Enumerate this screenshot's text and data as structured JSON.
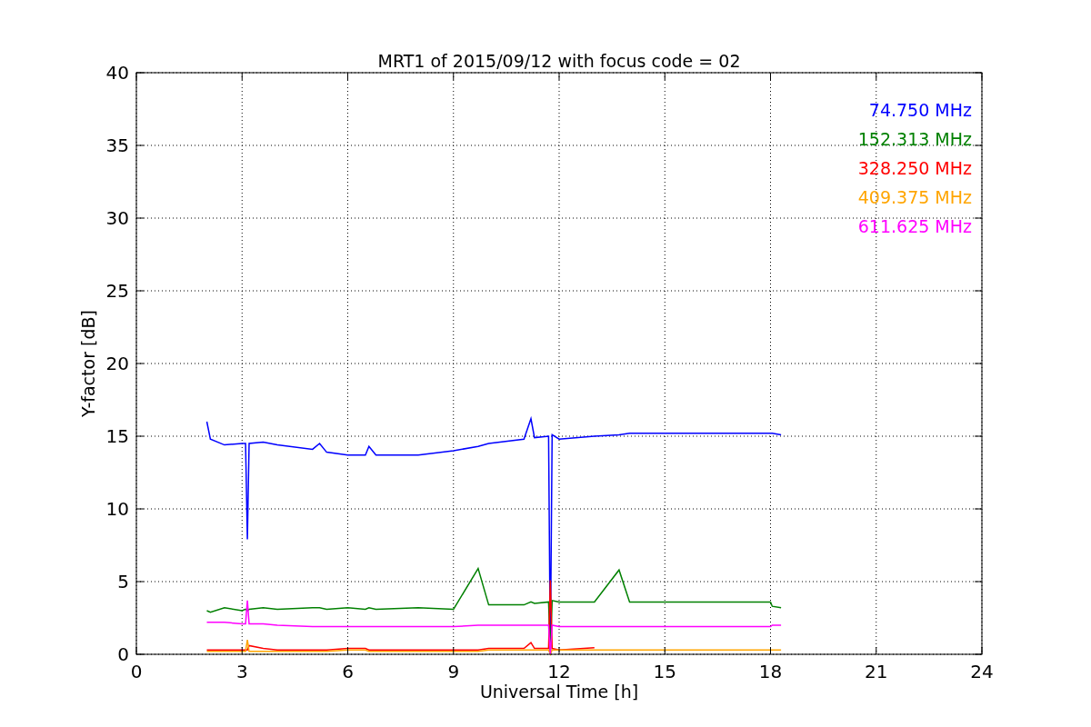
{
  "figure": {
    "chart_data": {
      "type": "line",
      "title": "MRT1 of 2015/09/12 with focus code = 02",
      "xlabel": "Universal Time [h]",
      "ylabel": "Y-factor [dB]",
      "x": [
        2,
        2.1,
        2.5,
        3,
        3.1,
        3.15,
        3.2,
        3.6,
        4,
        5,
        5.2,
        5.4,
        6,
        6.5,
        6.6,
        6.8,
        8,
        9,
        9.7,
        10,
        11,
        11.2,
        11.3,
        11.7,
        11.75,
        11.8,
        12,
        13,
        13.7,
        14,
        18,
        18.05,
        18.3
      ],
      "series": [
        {
          "name": "74.750 MHz",
          "color": "#0000ff",
          "values": [
            16,
            14.8,
            14.4,
            14.5,
            14.5,
            7.9,
            14.5,
            14.6,
            14.4,
            14.1,
            14.5,
            13.9,
            13.7,
            13.7,
            14.3,
            13.7,
            13.7,
            14.0,
            14.3,
            14.5,
            14.8,
            16.2,
            14.9,
            15.0,
            0,
            15.1,
            14.8,
            15.0,
            15.1,
            15.2,
            15.2,
            15.2,
            15.1
          ]
        },
        {
          "name": "152.313 MHz",
          "color": "#008000",
          "values": [
            3.0,
            2.9,
            3.2,
            3.0,
            3.1,
            3.0,
            3.1,
            3.2,
            3.1,
            3.2,
            3.2,
            3.1,
            3.2,
            3.1,
            3.2,
            3.1,
            3.2,
            3.1,
            5.9,
            3.4,
            3.4,
            3.6,
            3.5,
            3.6,
            0,
            3.7,
            3.6,
            3.6,
            5.8,
            3.6,
            3.6,
            3.3,
            3.2
          ]
        },
        {
          "name": "328.250 MHz",
          "color": "#ff0000",
          "values": [
            0.3,
            0.3,
            0.3,
            0.3,
            0.3,
            0.3,
            0.6,
            0.4,
            0.3,
            0.3,
            0.3,
            0.3,
            0.4,
            0.4,
            0.3,
            0.3,
            0.3,
            0.3,
            0.3,
            0.4,
            0.4,
            0.8,
            0.4,
            0.4,
            5.1,
            0.4,
            0.3,
            0.45,
            null,
            null,
            null,
            null,
            null
          ]
        },
        {
          "name": "409.375 MHz",
          "color": "#ffa500",
          "values": [
            0.2,
            0.2,
            0.2,
            0.2,
            0.2,
            1.0,
            0.2,
            0.2,
            0.2,
            0.2,
            0.2,
            0.2,
            0.3,
            0.3,
            0.2,
            0.2,
            0.2,
            0.2,
            0.2,
            0.3,
            0.3,
            0.3,
            0.3,
            0.3,
            0,
            0.3,
            0.3,
            0.3,
            0.3,
            0.3,
            0.3,
            0.3,
            0.3
          ]
        },
        {
          "name": "611.625 MHz",
          "color": "#ff00ff",
          "values": [
            2.2,
            2.2,
            2.2,
            2.1,
            2.1,
            3.7,
            2.1,
            2.1,
            2.0,
            1.9,
            1.9,
            1.9,
            1.9,
            1.9,
            1.9,
            1.9,
            1.9,
            1.9,
            2.0,
            2.0,
            2.0,
            2.0,
            2.0,
            2.0,
            0,
            2.0,
            1.9,
            1.9,
            1.9,
            1.9,
            1.9,
            2.0,
            2.0
          ]
        }
      ],
      "xlim": [
        0,
        24
      ],
      "ylim": [
        0,
        40
      ],
      "xticks": [
        0,
        3,
        6,
        9,
        12,
        15,
        18,
        21,
        24
      ],
      "yticks": [
        0,
        5,
        10,
        15,
        20,
        25,
        30,
        35,
        40
      ],
      "grid": true
    }
  }
}
